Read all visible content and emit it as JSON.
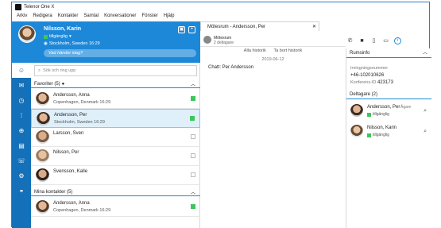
{
  "window": {
    "title": "Telenor One X"
  },
  "menu": [
    "Arkiv",
    "Redigera",
    "Kontakter",
    "Samtal",
    "Konversationer",
    "Fönster",
    "Hjälp"
  ],
  "profile": {
    "name": "Nilsson, Karin",
    "status": "tillgänglig",
    "location": "Stockholm, Sweden 16:29",
    "whats_happening": "Vad händer idag?"
  },
  "search": {
    "placeholder": "Sök och ring upp"
  },
  "favorites": {
    "header": "Favoriter (5)",
    "contacts": [
      {
        "name": "Andersson, Anna",
        "sub": "Copenhagen, Denmark 16:29",
        "online": true
      },
      {
        "name": "Andersson, Per",
        "sub": "Stockholm, Sweden 16:29",
        "online": true
      },
      {
        "name": "Larsson, Sven",
        "sub": "",
        "online": false
      },
      {
        "name": "Nilsson, Per",
        "sub": "",
        "online": false
      },
      {
        "name": "Svensson, Kalle",
        "sub": "",
        "online": true
      }
    ]
  },
  "my_contacts": {
    "header": "Mina kontakter (5)",
    "contacts": [
      {
        "name": "Andersson, Anna",
        "sub": "Copenhagen, Denmark 16:29",
        "online": true
      }
    ]
  },
  "chat": {
    "tab_label": "Mötesrum - Andersson, Per",
    "room_name": "Mötesrum",
    "room_sub": "2 deltagare",
    "all_history": "Alla historik",
    "delete_history": "Ta bort historik",
    "date": "2019-06-12",
    "messages": [
      "Chatt: Per Andersson"
    ]
  },
  "room_info": {
    "header": "Rumsinfo",
    "dial_label": "Inringningsnummer",
    "dial_value": "+46-102010626",
    "conf_label": "Konferens-ID",
    "conf_value": "423173",
    "participants_header": "Deltagare (2)",
    "participants": [
      {
        "name": "Andersson, Per",
        "role": "Ägare",
        "status": "tillgänglig"
      },
      {
        "name": "Nilsson, Karin",
        "role": "",
        "status": "tillgänglig"
      }
    ]
  }
}
